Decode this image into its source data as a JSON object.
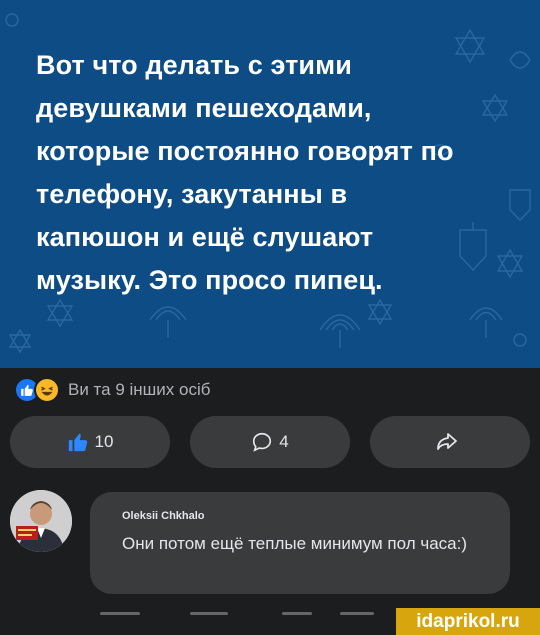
{
  "post": {
    "lines": [
      "Вот что делать с этими",
      "девушками пешеходами,",
      "которые постоянно говорят по",
      "телефону, закутанны в",
      "капюшон и ещё слушают",
      "музыку. Это просо пипец."
    ],
    "background_color": "#0d4c84"
  },
  "reactions": {
    "icons": [
      "like-icon",
      "haha-emoji-icon"
    ],
    "text": "Ви та 9 інших осіб"
  },
  "actions": {
    "like_count": "10",
    "comment_count": "4",
    "share_icon": "share-arrow-icon"
  },
  "comment": {
    "author": "Oleksii Chkhalo",
    "text": "Они потом ещё теплые минимум пол часа:)"
  },
  "watermark": "idaprikol.ru",
  "colors": {
    "like_blue": "#1877f2",
    "haha_yellow": "#f7b928",
    "button_gray": "#3a3b3c",
    "page_dark": "#1c1d1f",
    "watermark_gold": "#d7a60f"
  }
}
